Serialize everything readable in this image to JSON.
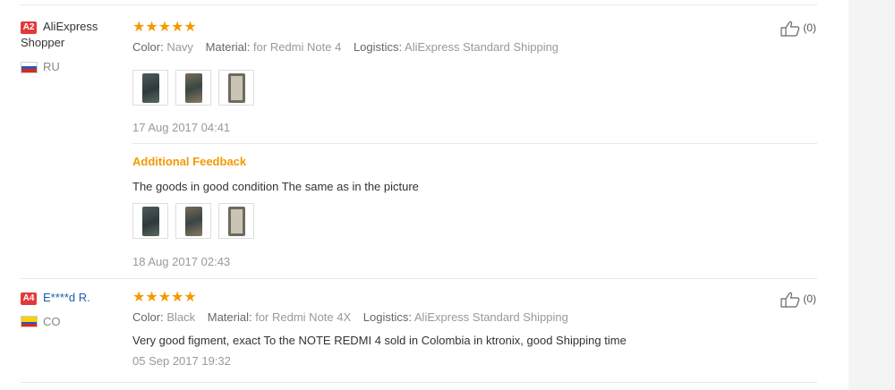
{
  "reviews": [
    {
      "badge": "A2",
      "user": "AliExpress Shopper",
      "country": "RU",
      "stars": "★★★★★",
      "attrs": [
        {
          "key": "Color:",
          "value": "Navy"
        },
        {
          "key": "Material:",
          "value": "for Redmi Note 4"
        },
        {
          "key": "Logistics:",
          "value": "AliExpress Standard Shipping"
        }
      ],
      "date": "17 Aug 2017 04:41",
      "likes": "(0)",
      "additional": {
        "title": "Additional Feedback",
        "text": "The goods in good condition The same as in the picture",
        "date": "18 Aug 2017 02:43"
      }
    },
    {
      "badge": "A4",
      "user": "E****d R.",
      "country": "CO",
      "stars": "★★★★★",
      "attrs": [
        {
          "key": "Color:",
          "value": "Black"
        },
        {
          "key": "Material:",
          "value": "for Redmi Note 4X"
        },
        {
          "key": "Logistics:",
          "value": "AliExpress Standard Shipping"
        }
      ],
      "text": "Very good figment, exact To the NOTE REDMI 4 sold in Colombia in ktronix, good Shipping time",
      "date": "05 Sep 2017 19:32",
      "likes": "(0)"
    }
  ],
  "colors": {
    "accent": "#f29a00",
    "badge": "#e4393c",
    "link": "#1a5ea8"
  },
  "icons": {
    "like": "thumbs-up-icon",
    "flag_ru": "flag-ru-icon",
    "flag_co": "flag-co-icon"
  }
}
